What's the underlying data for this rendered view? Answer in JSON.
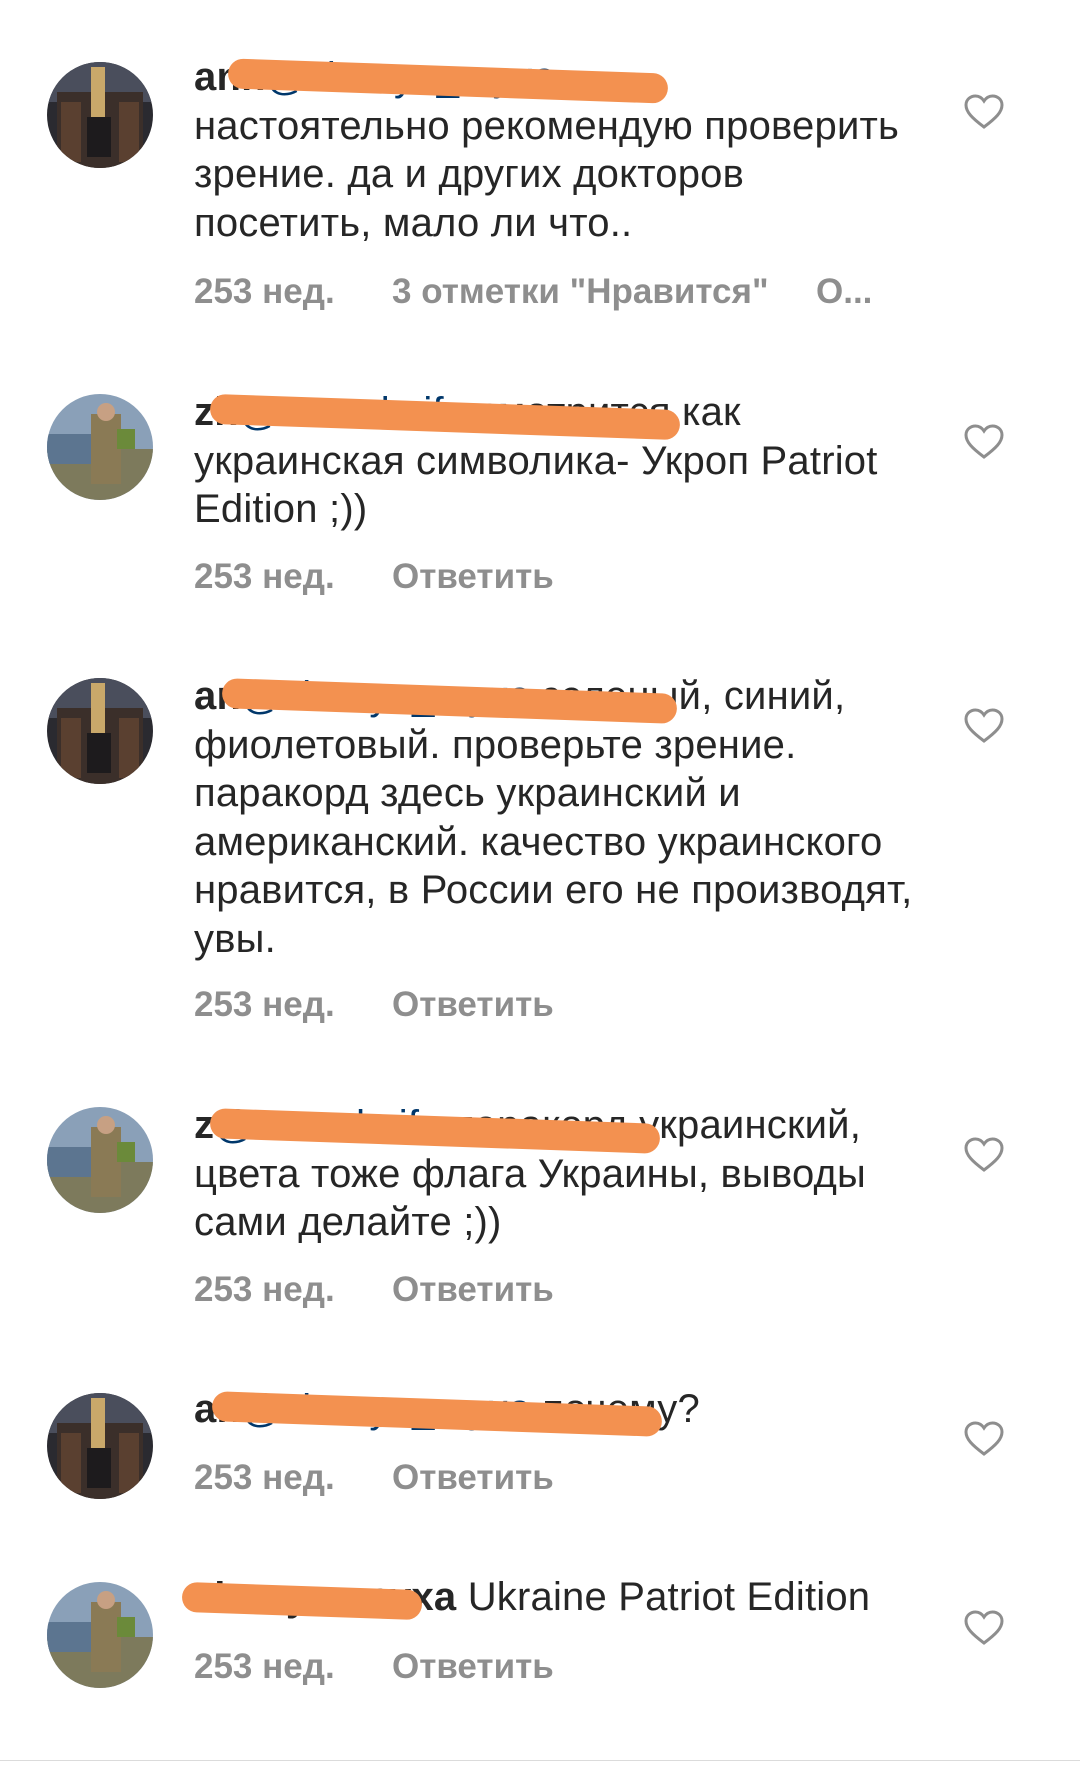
{
  "comments": [
    {
      "username": "ann",
      "mention": "@zhenya_myxa",
      "text": "настоятельно рекомендую проверить зрение. да и других докторов посетить, мало ли что..",
      "time": "253 нед.",
      "likes": "3 отметки \"Нравится\"",
      "reply": "О..."
    },
    {
      "username": "zh",
      "mention": "@anna.knife",
      "text": "смотрится как украинская символика- Укроп Patriot Edition ;))",
      "time": "253 нед.",
      "reply": "Ответить"
    },
    {
      "username": "an",
      "mention": "@zhenya_myxa",
      "text": "зеленый, синий, фиолетовый. проверьте зрение. паракорд здесь украинский и американский. качество украинского нравится, в России его не производят, увы.",
      "time": "253 нед.",
      "reply": "Ответить"
    },
    {
      "username": "z",
      "mention": "@anna.knife",
      "text": "паракорд украинский, цвета тоже флага Украины, выводы сами делайте ;))",
      "time": "253 нед.",
      "reply": "Ответить"
    },
    {
      "username": "an",
      "mention": "@zhenya_myxa",
      "text": "почему?",
      "time": "253 нед.",
      "reply": "Ответить"
    },
    {
      "username": "zhenya_myxa",
      "mention": "",
      "text": "Ukraine Patriot Edition",
      "time": "253 нед.",
      "reply": "Ответить"
    }
  ],
  "colors": {
    "redaction": "#f39150",
    "mention": "#00376b",
    "meta": "#8e8e8e"
  }
}
